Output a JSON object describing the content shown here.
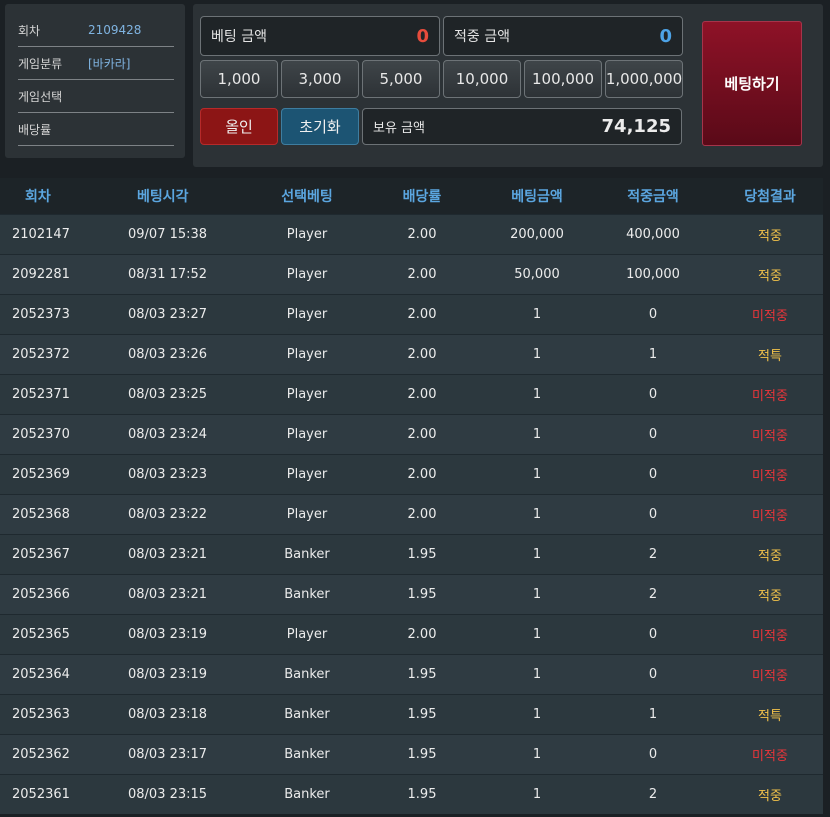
{
  "info": {
    "round_label": "회차",
    "round_value": "2109428",
    "category_label": "게임분류",
    "category_value": "[바카라]",
    "select_label": "게임선택",
    "select_value": "",
    "odds_label": "배당률",
    "odds_value": ""
  },
  "bet": {
    "bet_amount_label": "베팅 금액",
    "bet_amount_value": "0",
    "win_amount_label": "적중 금액",
    "win_amount_value": "0",
    "chips": [
      "1,000",
      "3,000",
      "5,000",
      "10,000",
      "100,000",
      "1,000,000"
    ],
    "allin_label": "올인",
    "reset_label": "초기화",
    "balance_label": "보유 금액",
    "balance_value": "74,125",
    "submit_label": "베팅하기"
  },
  "colors": {
    "bet_amount": "#e74c3c",
    "win_amount": "#4da3e6",
    "win": "#f2c24a",
    "lose": "#e9353a"
  },
  "table": {
    "headers": [
      "회차",
      "베팅시각",
      "선택베팅",
      "배당률",
      "베팅금액",
      "적중금액",
      "당첨결과"
    ],
    "rows": [
      [
        "2102147",
        "09/07 15:38",
        "Player",
        "2.00",
        "200,000",
        "400,000",
        "적중"
      ],
      [
        "2092281",
        "08/31 17:52",
        "Player",
        "2.00",
        "50,000",
        "100,000",
        "적중"
      ],
      [
        "2052373",
        "08/03 23:27",
        "Player",
        "2.00",
        "1",
        "0",
        "미적중"
      ],
      [
        "2052372",
        "08/03 23:26",
        "Player",
        "2.00",
        "1",
        "1",
        "적특"
      ],
      [
        "2052371",
        "08/03 23:25",
        "Player",
        "2.00",
        "1",
        "0",
        "미적중"
      ],
      [
        "2052370",
        "08/03 23:24",
        "Player",
        "2.00",
        "1",
        "0",
        "미적중"
      ],
      [
        "2052369",
        "08/03 23:23",
        "Player",
        "2.00",
        "1",
        "0",
        "미적중"
      ],
      [
        "2052368",
        "08/03 23:22",
        "Player",
        "2.00",
        "1",
        "0",
        "미적중"
      ],
      [
        "2052367",
        "08/03 23:21",
        "Banker",
        "1.95",
        "1",
        "2",
        "적중"
      ],
      [
        "2052366",
        "08/03 23:21",
        "Banker",
        "1.95",
        "1",
        "2",
        "적중"
      ],
      [
        "2052365",
        "08/03 23:19",
        "Player",
        "2.00",
        "1",
        "0",
        "미적중"
      ],
      [
        "2052364",
        "08/03 23:19",
        "Banker",
        "1.95",
        "1",
        "0",
        "미적중"
      ],
      [
        "2052363",
        "08/03 23:18",
        "Banker",
        "1.95",
        "1",
        "1",
        "적특"
      ],
      [
        "2052362",
        "08/03 23:17",
        "Banker",
        "1.95",
        "1",
        "0",
        "미적중"
      ],
      [
        "2052361",
        "08/03 23:15",
        "Banker",
        "1.95",
        "1",
        "2",
        "적중"
      ]
    ]
  }
}
